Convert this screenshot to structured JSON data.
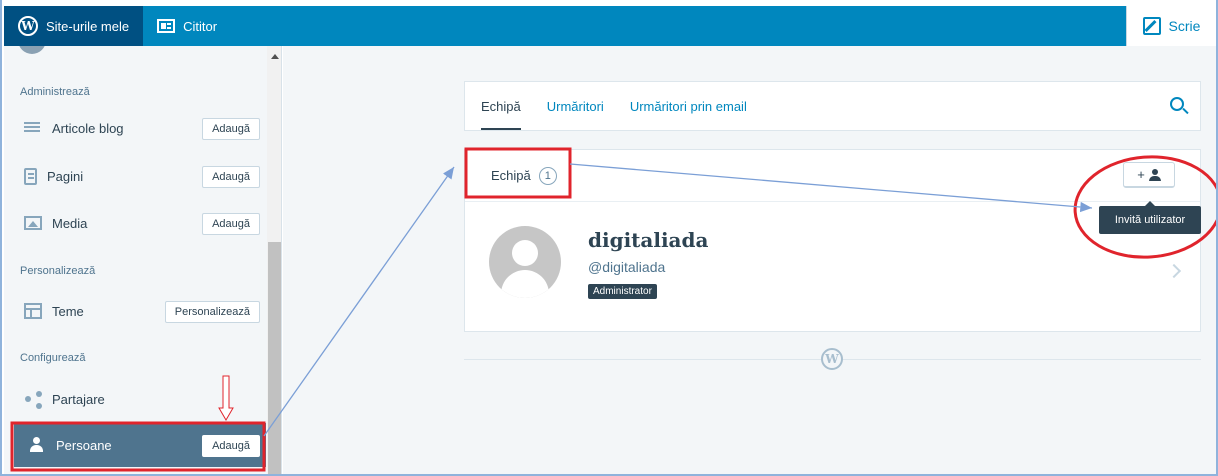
{
  "masterbar": {
    "my_sites": "Site-urile mele",
    "reader": "Cititor",
    "write": "Scrie",
    "logo_letter": "W"
  },
  "sidebar": {
    "section_manage": "Administrează",
    "section_personalize": "Personalizează",
    "section_configure": "Configurează",
    "items": [
      {
        "label": "Articole blog",
        "action": "Adaugă",
        "icon": "posts-icon"
      },
      {
        "label": "Pagini",
        "action": "Adaugă",
        "icon": "page-icon"
      },
      {
        "label": "Media",
        "action": "Adaugă",
        "icon": "media-icon"
      },
      {
        "label": "Teme",
        "action": "Personalizează",
        "icon": "themes-icon"
      },
      {
        "label": "Partajare",
        "icon": "share-icon"
      },
      {
        "label": "Persoane",
        "action": "Adaugă",
        "icon": "person-icon",
        "selected": true
      }
    ]
  },
  "tabs": [
    {
      "label": "Echipă",
      "active": true
    },
    {
      "label": "Urmăritori"
    },
    {
      "label": "Urmăritori prin email"
    }
  ],
  "team": {
    "heading": "Echipă",
    "count": "1",
    "invite_tooltip": "Invită utilizator",
    "invite_glyph": "+"
  },
  "user": {
    "name": "digitaliada",
    "handle": "@digitaliada",
    "role": "Administrator"
  },
  "colors": {
    "masterbar": "#0087be",
    "masterbar_active": "#005082",
    "sidebar_selected": "#4f748e",
    "annotation_red": "#e0242c",
    "annotation_arrow": "#7b9fd6"
  }
}
